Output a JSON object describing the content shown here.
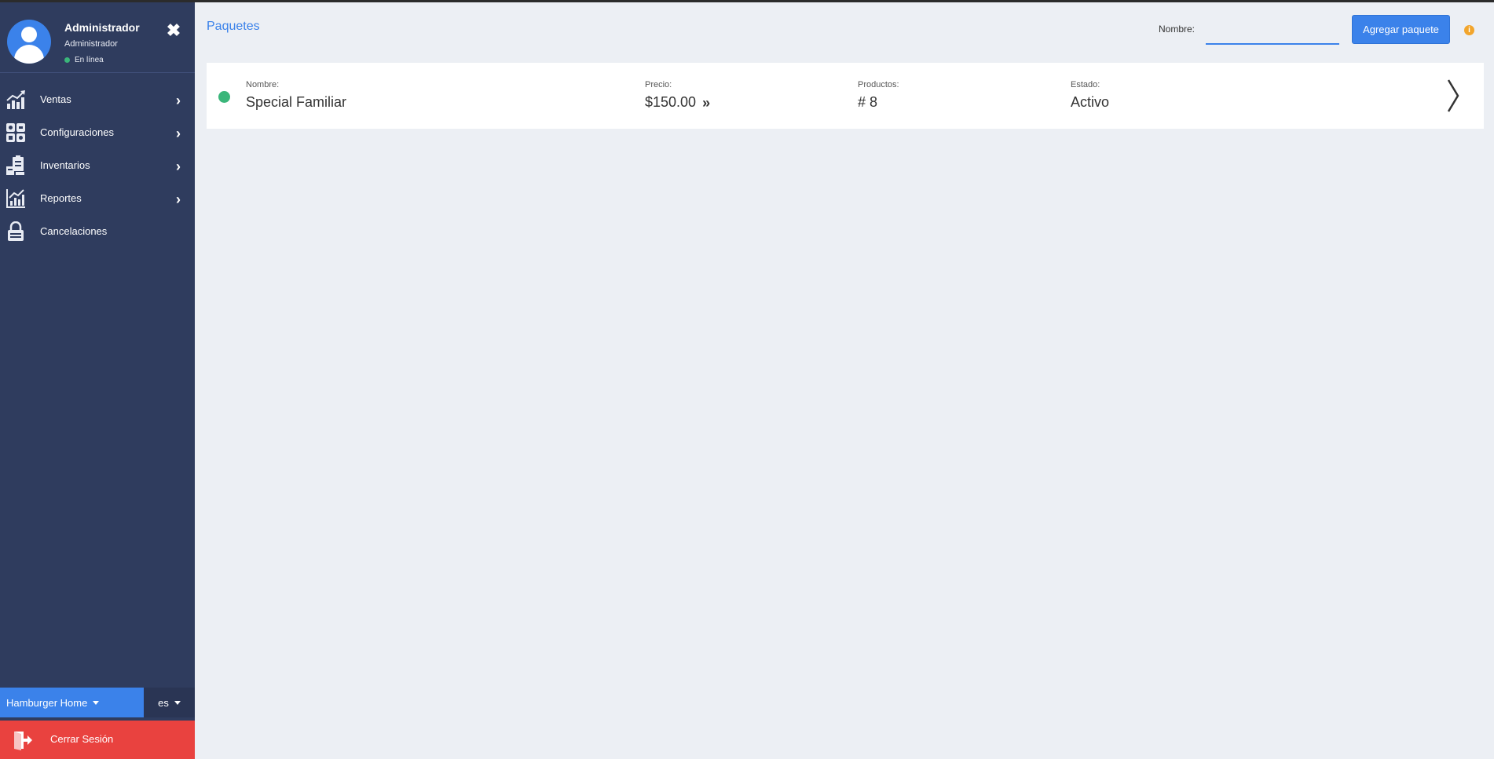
{
  "colors": {
    "sidebar_bg": "#2f3c5e",
    "accent": "#3b82ea",
    "logout": "#e9423f",
    "online": "#3ab67a",
    "info": "#f2a52c"
  },
  "profile": {
    "name": "Administrador",
    "role": "Administrador",
    "status": "En línea",
    "avatar_icon": "user-avatar-icon",
    "close_icon": "close-icon"
  },
  "close_glyph": "✖",
  "nav": {
    "items": [
      {
        "label": "Ventas",
        "icon": "sales-chart-icon",
        "chevron": "›"
      },
      {
        "label": "Configuraciones",
        "icon": "grid-settings-icon",
        "chevron": "›"
      },
      {
        "label": "Inventarios",
        "icon": "inventory-icon",
        "chevron": "›"
      },
      {
        "label": "Reportes",
        "icon": "reports-chart-icon",
        "chevron": "›"
      },
      {
        "label": "Cancelaciones",
        "icon": "lock-icon"
      }
    ]
  },
  "footer": {
    "branch": "Hamburger Home",
    "language": "es",
    "logout": "Cerrar Sesión"
  },
  "header": {
    "title": "Paquetes",
    "filter_label": "Nombre:",
    "filter_value": "",
    "add_button": "Agregar paquete",
    "info_glyph": "i"
  },
  "packages": [
    {
      "status_color": "#3ab67a",
      "nombre_label": "Nombre:",
      "nombre": "Special Familiar",
      "precio_label": "Precio:",
      "precio": "$150.00",
      "precio_icon": "»",
      "productos_label": "Productos:",
      "productos": "# 8",
      "estado_label": "Estado:",
      "estado": "Activo"
    }
  ]
}
